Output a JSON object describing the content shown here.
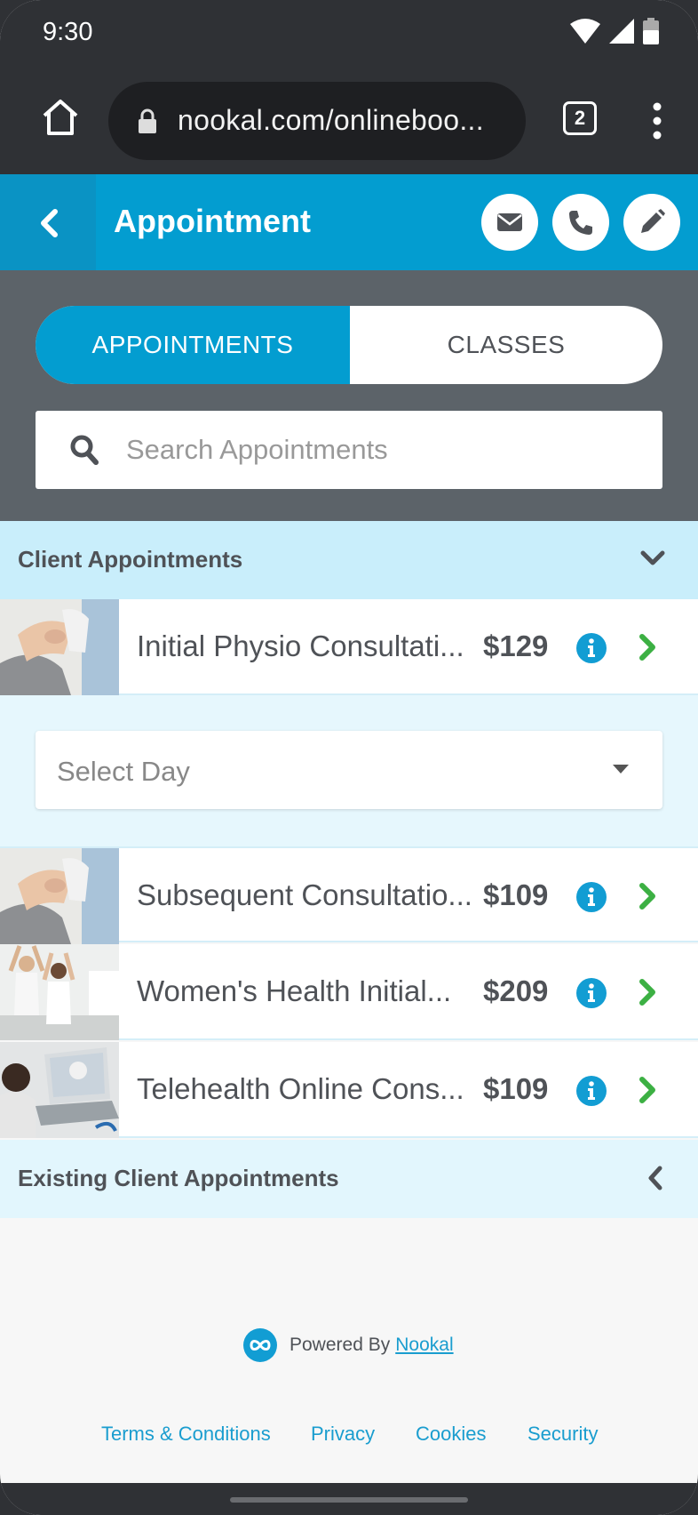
{
  "status_bar": {
    "time": "9:30"
  },
  "browser": {
    "url": "nookal.com/onlineboo...",
    "tab_count": "2"
  },
  "header": {
    "title": "Appointment"
  },
  "toggle": {
    "appointments": "APPOINTMENTS",
    "classes": "CLASSES",
    "active": "APPOINTMENTS"
  },
  "search": {
    "placeholder": "Search Appointments",
    "value": ""
  },
  "client_section": {
    "title": "Client Appointments",
    "expanded": true
  },
  "appointments": [
    {
      "name": "Initial Physio Consultati...",
      "price": "$129",
      "thumb": "physio-knee"
    },
    {
      "name": "Subsequent Consultatio...",
      "price": "$109",
      "thumb": "physio-knee"
    },
    {
      "name": "Women's Health Initial...",
      "price": "$209",
      "thumb": "exercise-stretch"
    },
    {
      "name": "Telehealth Online Cons...",
      "price": "$109",
      "thumb": "laptop-call"
    }
  ],
  "day_select": {
    "value": "Select Day"
  },
  "existing_section": {
    "title": "Existing Client Appointments",
    "expanded": false
  },
  "footer": {
    "powered_by": "Powered By",
    "brand": "Nookal",
    "links": [
      "Terms & Conditions",
      "Privacy",
      "Cookies",
      "Security"
    ]
  },
  "colors": {
    "primary": "#039dd0",
    "accent_green": "#3cb043",
    "text": "#4f5257",
    "section_bg": "#c9eefb"
  }
}
